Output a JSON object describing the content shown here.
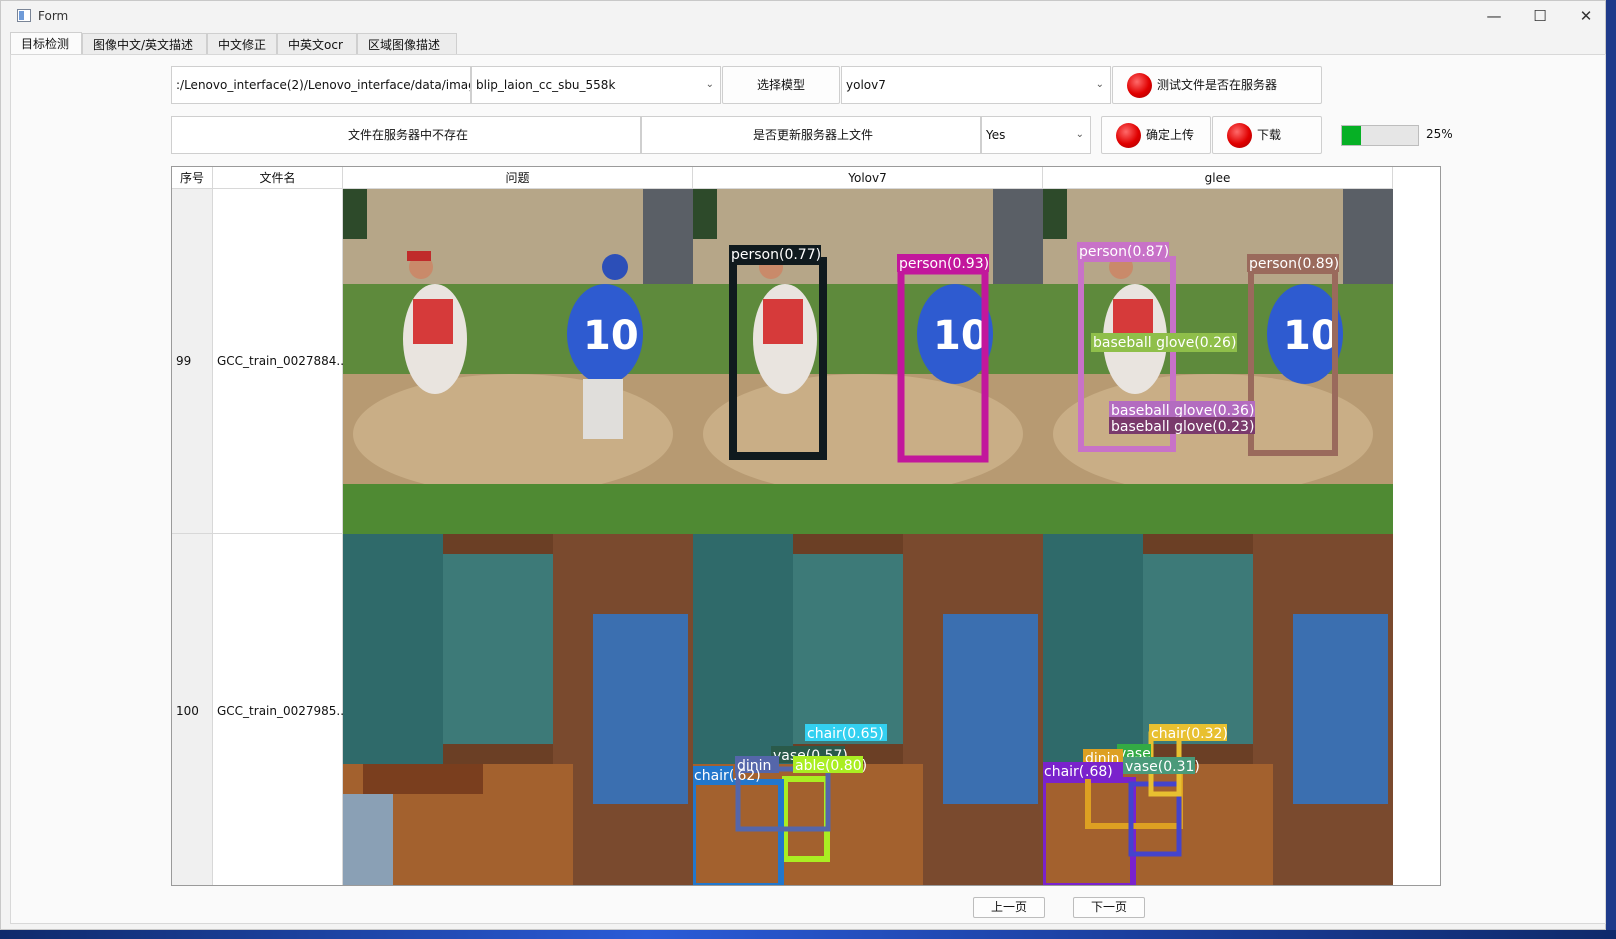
{
  "window": {
    "title": "Form",
    "minimize_glyph": "—",
    "maximize_glyph": "☐",
    "close_glyph": "✕"
  },
  "tabs": [
    {
      "label": "目标检测",
      "active": true
    },
    {
      "label": "图像中文/英文描述",
      "active": false
    },
    {
      "label": "中文修正",
      "active": false
    },
    {
      "label": "中英文ocr",
      "active": false
    },
    {
      "label": "区域图像描述",
      "active": false
    }
  ],
  "controls": {
    "path_value": ":/Lenovo_interface(2)/Lenovo_interface/data/image",
    "caption_model": "blip_laion_cc_sbu_558k",
    "select_model_label": "选择模型",
    "detector_model": "yolov7",
    "test_server_label": "测试文件是否在服务器",
    "server_status": "文件在服务器中不存在",
    "update_question": "是否更新服务器上文件",
    "update_choice": "Yes",
    "confirm_upload_label": "确定上传",
    "download_label": "下载",
    "progress_percent": 25,
    "progress_text": "25%"
  },
  "table": {
    "headers": [
      "序号",
      "文件名",
      "问题",
      "Yolov7",
      "glee"
    ],
    "rows": [
      {
        "index": "99",
        "filename": "GCC_train_0027884...",
        "yolo_labels": [
          "person(0.77)",
          "person(0.93)"
        ],
        "glee_labels": [
          "person(0.87)",
          "person(0.89)",
          "baseball glove(0.26)",
          "baseball glove(0.36)",
          "baseball glove(0.23)"
        ]
      },
      {
        "index": "100",
        "filename": "GCC_train_0027985...",
        "yolo_labels": [
          "chair(0.65)",
          "vase(0.57)",
          "dinin",
          "able(0.80)",
          "chair(",
          ".62)"
        ],
        "glee_labels": [
          "chair(0.32)",
          "vase",
          "vase(0.31)",
          "dinin",
          "chair(",
          ".68)"
        ]
      }
    ]
  },
  "pagination": {
    "prev_label": "上一页",
    "next_label": "下一页"
  },
  "colors": {
    "progress_fill": "#06b025",
    "button_dot": "#e00000",
    "yolo_person_1": "#101a1e",
    "yolo_person_2": "#c2179c",
    "glee_person_1": "#c872c8",
    "glee_person_2": "#9a6a5c",
    "glove_label": "#8fbf4a",
    "chair_label": "#33d0f0"
  }
}
